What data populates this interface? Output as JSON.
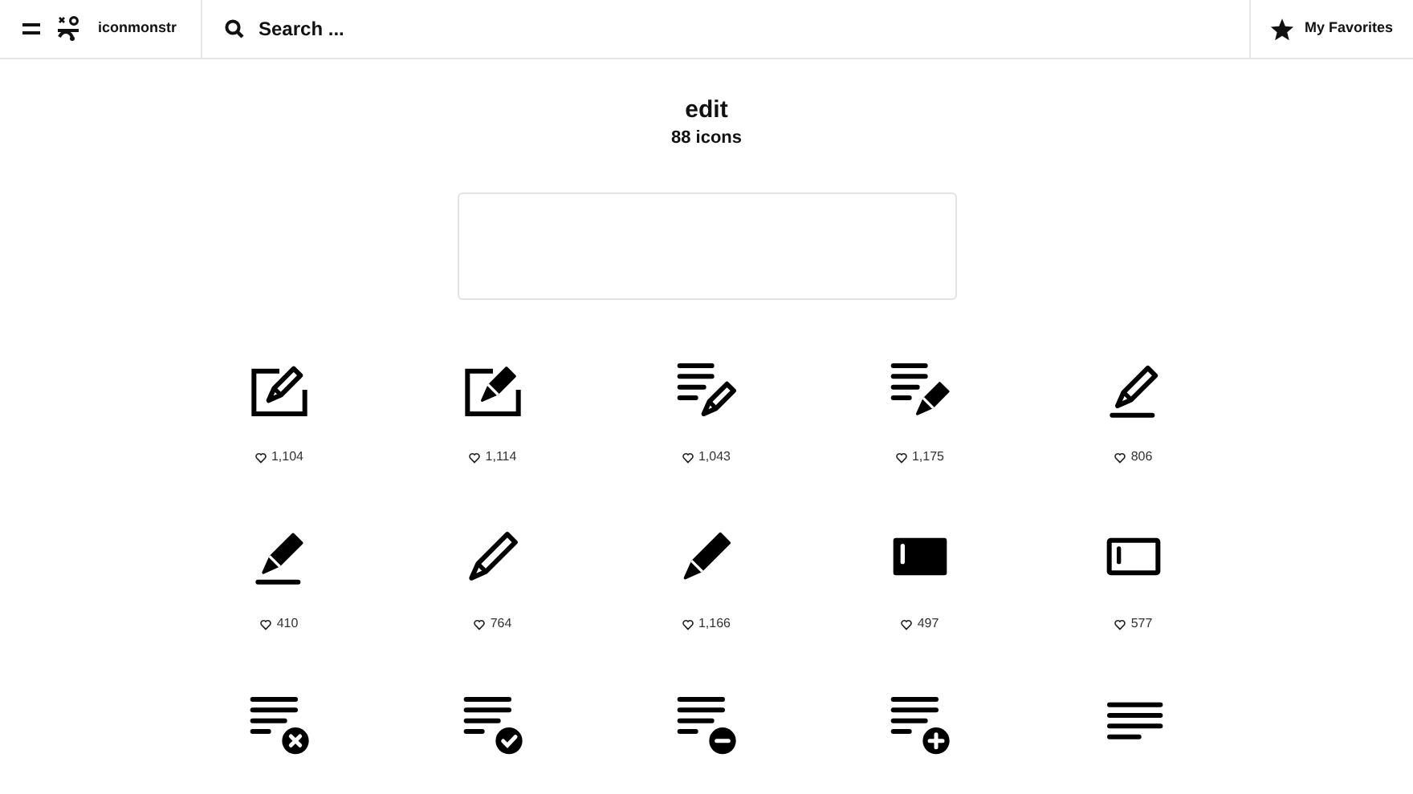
{
  "header": {
    "brand": "iconmonstr",
    "search_placeholder": "Search ...",
    "favorites": "My Favorites"
  },
  "title": "edit",
  "subtitle": "88 icons",
  "icons": [
    {
      "kind": "note-pencil-outline",
      "likes": "1,104"
    },
    {
      "kind": "note-pencil-solid",
      "likes": "1,114"
    },
    {
      "kind": "lines-pencil-outline",
      "likes": "1,043"
    },
    {
      "kind": "lines-pencil-solid",
      "likes": "1,175"
    },
    {
      "kind": "underline-pencil-outline",
      "likes": "806"
    },
    {
      "kind": "underline-pencil-solid",
      "likes": "410"
    },
    {
      "kind": "pencil-outline",
      "likes": "764"
    },
    {
      "kind": "pencil-solid",
      "likes": "1,166"
    },
    {
      "kind": "panel-solid",
      "likes": "497"
    },
    {
      "kind": "panel-outline",
      "likes": "577"
    },
    {
      "kind": "lines-cross"
    },
    {
      "kind": "lines-check"
    },
    {
      "kind": "lines-minus"
    },
    {
      "kind": "lines-plus"
    },
    {
      "kind": "lines"
    }
  ]
}
